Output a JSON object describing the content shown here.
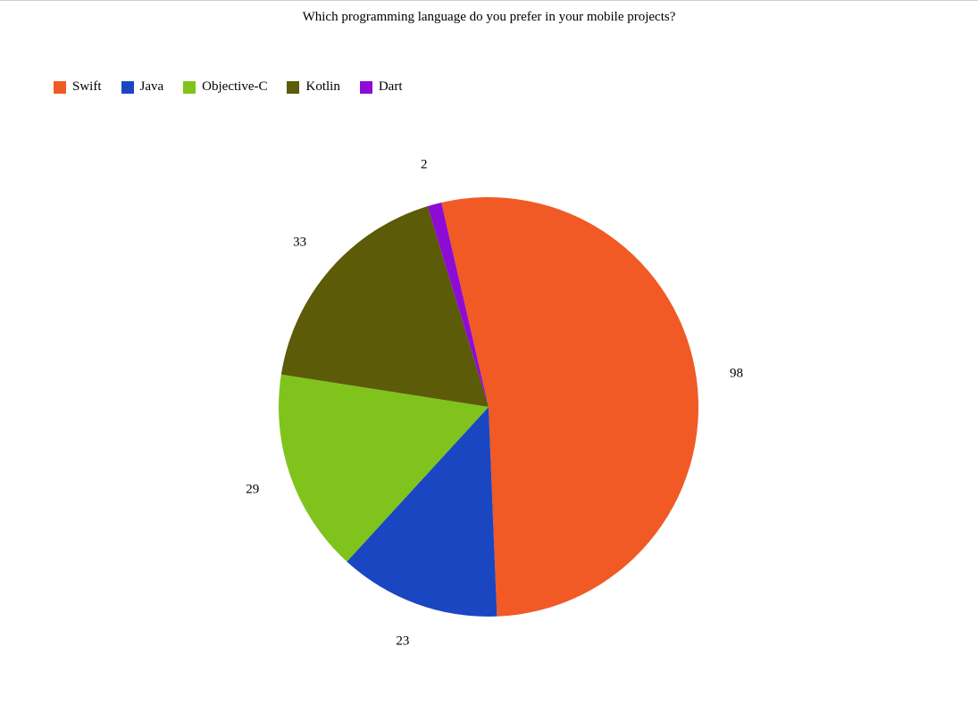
{
  "chart_data": {
    "type": "pie",
    "title": "Which programming language do you prefer in your mobile projects?",
    "series": [
      {
        "name": "Swift",
        "value": 98,
        "color": "#f15a24"
      },
      {
        "name": "Java",
        "value": 23,
        "color": "#1b46c2"
      },
      {
        "name": "Objective-C",
        "value": 29,
        "color": "#7fc31c"
      },
      {
        "name": "Kotlin",
        "value": 33,
        "color": "#5b5b08"
      },
      {
        "name": "Dart",
        "value": 2,
        "color": "#8e0bd6"
      }
    ],
    "start_angle_deg": -103,
    "radius": 235,
    "center": {
      "x": 547,
      "y": 315
    },
    "label_offset": 45
  }
}
